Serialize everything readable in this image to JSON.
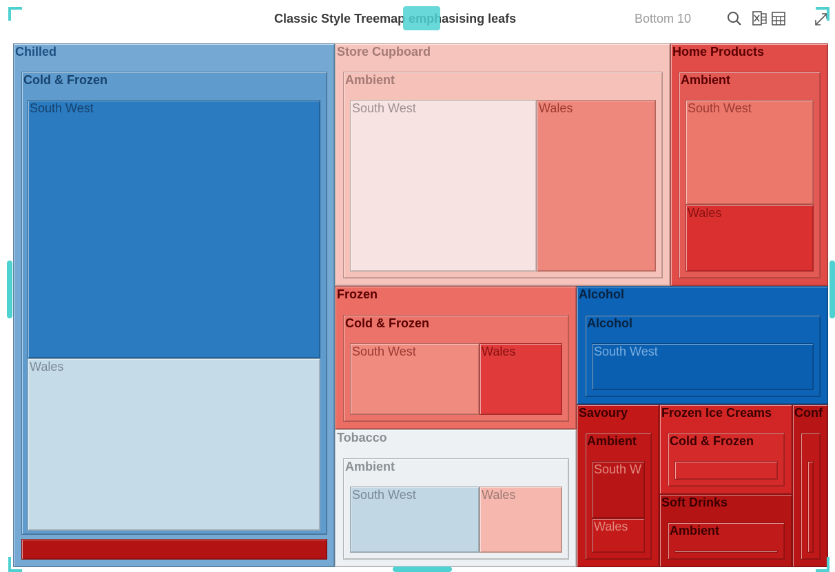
{
  "header": {
    "title": "Classic Style Treemap emphasising leafs",
    "filter_label": "Bottom 10",
    "tools": [
      {
        "name": "search-icon"
      },
      {
        "name": "excel-export-icon"
      },
      {
        "name": "table-view-icon"
      },
      {
        "name": "expand-icon"
      }
    ]
  },
  "colors": {
    "accent_teal": "#4fd1d1",
    "title": "#3a3a3a",
    "muted": "#9a9a9a"
  },
  "chart_data": {
    "type": "treemap",
    "title": "Classic Style Treemap emphasising leafs",
    "levels": [
      "category",
      "segment",
      "region"
    ],
    "nodes": [
      {
        "name": "Chilled",
        "color": "#75a9d3",
        "text": "#1f4f80",
        "children": [
          {
            "name": "Cold & Frozen",
            "color": "#5f9ccd",
            "text": "#16426e",
            "children": [
              {
                "name": "South West",
                "color": "#2a7bc0",
                "text": "#16426e"
              },
              {
                "name": "Wales",
                "color": "#c6dbe8",
                "text": "#7a8a96"
              }
            ]
          },
          {
            "name": "",
            "color": "#b31313",
            "text": "#5a0000",
            "children": []
          }
        ]
      },
      {
        "name": "Store Cupboard",
        "color": "#f6c4bc",
        "text": "#a47a74",
        "children": [
          {
            "name": "Ambient",
            "color": "#f5c1b8",
            "text": "#a47a74",
            "children": [
              {
                "name": "South West",
                "color": "#f7e4e2",
                "text": "#9c9090"
              },
              {
                "name": "Wales",
                "color": "#ef887c",
                "text": "#9c3a32"
              }
            ]
          }
        ]
      },
      {
        "name": "Home Products",
        "color": "#e14c48",
        "text": "#5a0000",
        "children": [
          {
            "name": "Ambient",
            "color": "#e35a55",
            "text": "#5a0000",
            "children": [
              {
                "name": "South West",
                "color": "#ec776b",
                "text": "#9c3a32"
              },
              {
                "name": "Wales",
                "color": "#da3030",
                "text": "#8a1010"
              }
            ]
          }
        ]
      },
      {
        "name": "Frozen",
        "color": "#eb6d64",
        "text": "#5a0000",
        "children": [
          {
            "name": "Cold & Frozen",
            "color": "#ec7369",
            "text": "#5a0000",
            "children": [
              {
                "name": "South West",
                "color": "#f08b80",
                "text": "#9c3a32"
              },
              {
                "name": "Wales",
                "color": "#e03b3a",
                "text": "#8a1010"
              }
            ]
          }
        ]
      },
      {
        "name": "Alcohol",
        "color": "#0d63b6",
        "text": "#08223f",
        "children": [
          {
            "name": "Alcohol",
            "color": "#0d63b6",
            "text": "#08223f",
            "children": [
              {
                "name": "South West",
                "color": "#0b5fb0",
                "text": "#7aaee0"
              }
            ]
          }
        ]
      },
      {
        "name": "Tobacco",
        "color": "#eef1f3",
        "text": "#8a8f93",
        "children": [
          {
            "name": "Ambient",
            "color": "#edf0f2",
            "text": "#8a8f93",
            "children": [
              {
                "name": "South West",
                "color": "#c1d7e4",
                "text": "#7a8a96"
              },
              {
                "name": "Wales",
                "color": "#f6b8ae",
                "text": "#9c7a74"
              }
            ]
          }
        ]
      },
      {
        "name": "Savoury",
        "color": "#c21818",
        "text": "#3a0000",
        "children": [
          {
            "name": "Ambient",
            "color": "#c01818",
            "text": "#3a0000",
            "children": [
              {
                "name": "South W",
                "color": "#b81616",
                "text": "#e28a80"
              },
              {
                "name": "Wales",
                "color": "#c41a1a",
                "text": "#e28a80"
              }
            ]
          }
        ]
      },
      {
        "name": "Frozen Ice Creams",
        "color": "#d22626",
        "text": "#3a0000",
        "children": [
          {
            "name": "Cold & Frozen",
            "color": "#d42a2a",
            "text": "#3a0000",
            "children": [
              {
                "name": "",
                "color": "#d42a2a",
                "text": "#3a0000"
              }
            ]
          }
        ]
      },
      {
        "name": "Soft Drinks",
        "color": "#b51414",
        "text": "#3a0000",
        "children": [
          {
            "name": "Ambient",
            "color": "#c01a1a",
            "text": "#3a0000",
            "children": [
              {
                "name": "",
                "color": "#c01a1a",
                "text": "#3a0000"
              }
            ]
          }
        ]
      },
      {
        "name": "Conf",
        "color": "#b81616",
        "text": "#3a0000",
        "children": [
          {
            "name": "",
            "color": "#be1818",
            "text": "#3a0000",
            "children": [
              {
                "name": "",
                "color": "#be1818",
                "text": "#3a0000"
              }
            ]
          }
        ]
      }
    ]
  }
}
